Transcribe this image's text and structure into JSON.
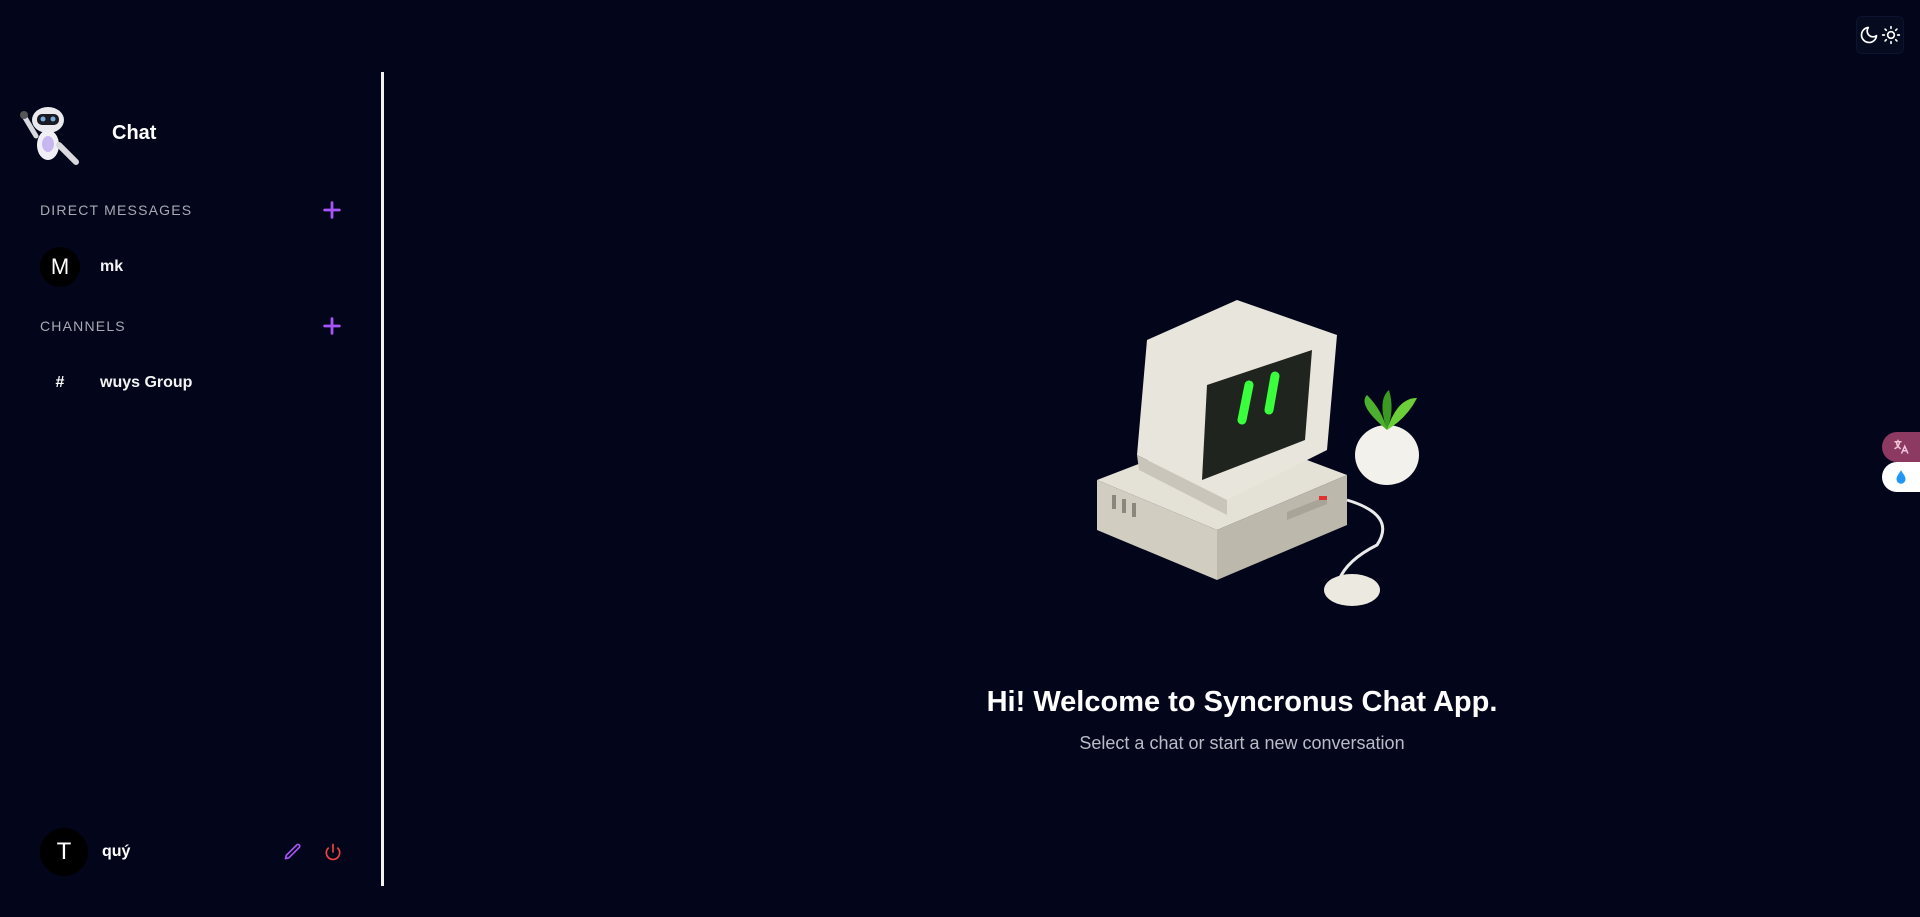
{
  "app": {
    "title": "Chat"
  },
  "theme": {
    "dark_icon": "moon-icon",
    "light_icon": "sun-icon"
  },
  "sidebar": {
    "direct_messages": {
      "title": "DIRECT MESSAGES",
      "add_icon": "plus-icon",
      "items": [
        {
          "initial": "M",
          "name": "mk"
        }
      ]
    },
    "channels": {
      "title": "CHANNELS",
      "add_icon": "plus-icon",
      "items": [
        {
          "symbol": "#",
          "name": "wuys Group"
        }
      ]
    },
    "profile": {
      "initial": "T",
      "name": "quý",
      "edit_icon": "pencil-icon",
      "logout_icon": "power-icon"
    }
  },
  "main": {
    "illustration": "retro-computer-illustration",
    "welcome_title": "Hi! Welcome to Syncronus Chat App.",
    "welcome_subtitle": "Select a chat or start a new conversation"
  },
  "side_widgets": [
    "translate-icon",
    "water-drop-icon"
  ],
  "colors": {
    "background": "#03061a",
    "accent": "#a855f7",
    "danger": "#ef4444",
    "divider": "#f2f2f2"
  }
}
